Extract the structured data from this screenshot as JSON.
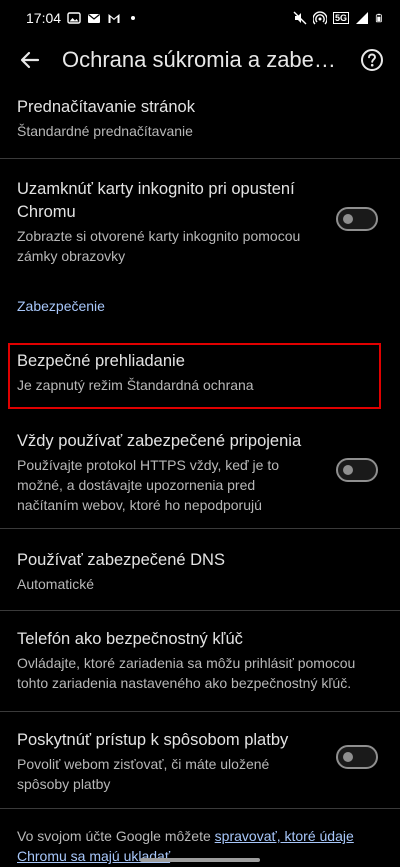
{
  "status_bar": {
    "time": "17:04",
    "network": "5G",
    "left_icons": [
      "gallery-icon",
      "mail-icon",
      "gmail-icon"
    ],
    "right_icons": [
      "mute-icon",
      "hotspot-icon",
      "signal-icon",
      "battery-icon"
    ]
  },
  "app_bar": {
    "title": "Ochrana súkromia a zabe…",
    "back_icon": "arrow-left-icon",
    "help_icon": "help-circle-icon"
  },
  "settings": {
    "preload": {
      "title": "Prednačítavanie stránok",
      "subtitle": "Štandardné prednačítavanie"
    },
    "incognito_lock": {
      "title": "Uzamknúť karty inkognito pri opustení Chromu",
      "subtitle": "Zobrazte si otvorené karty inkognito pomocou zámky obrazovky",
      "enabled": false
    },
    "section_security": "Zabezpečenie",
    "safe_browsing": {
      "title": "Bezpečné prehliadanie",
      "subtitle": "Je zapnutý režim Štandardná ochrana"
    },
    "https": {
      "title": "Vždy používať zabezpečené pripojenia",
      "subtitle": "Používajte protokol HTTPS vždy, keď je to možné, a dostávajte upozornenia pred načítaním webov, ktoré ho nepodporujú",
      "enabled": false
    },
    "secure_dns": {
      "title": "Používať zabezpečené DNS",
      "subtitle": "Automatické"
    },
    "security_key": {
      "title": "Telefón ako bezpečnostný kľúč",
      "subtitle": "Ovládajte, ktoré zariadenia sa môžu prihlásiť pomocou tohto zariadenia nastaveného ako bezpečnostný kľúč."
    },
    "payment": {
      "title": "Poskytnúť prístup k spôsobom platby",
      "subtitle": "Povoliť webom zisťovať, či máte uložené spôsoby platby",
      "enabled": false
    }
  },
  "footer": {
    "text": "Vo svojom účte Google môžete ",
    "link": "spravovať, ktoré údaje Chromu sa majú ukladať"
  },
  "colors": {
    "background": "#000000",
    "accent": "#a8c7fa",
    "highlight": "#e00000"
  }
}
